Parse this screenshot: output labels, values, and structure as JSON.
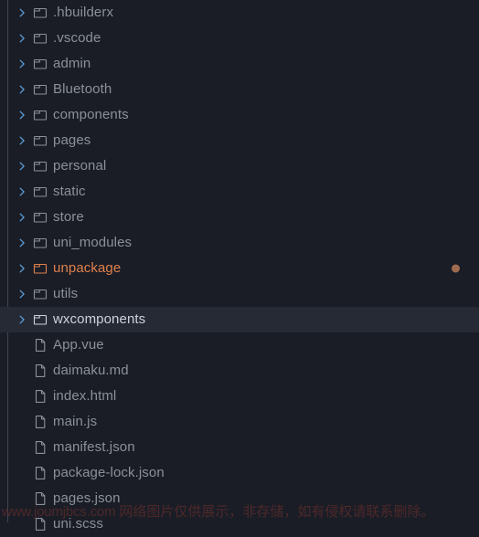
{
  "theme": {
    "background": "#1a1d26",
    "row_selected_background": "#252a35",
    "text": "#8b9199",
    "text_selected": "#cdd3da",
    "ignored_text": "#e0814c",
    "chevron": "#5a9bd5",
    "status_dot": "#9e6b50",
    "guide_line": "#41454f",
    "watermark_text": "#6d2f2c"
  },
  "explorer": {
    "rows": [
      {
        "name": ".hbuilderx",
        "kind": "folder",
        "icon": "folder-icon",
        "twisty": "chevron-right-icon",
        "expanded": false,
        "selected": false,
        "ignored": false,
        "status_dot": false
      },
      {
        "name": ".vscode",
        "kind": "folder",
        "icon": "folder-icon",
        "twisty": "chevron-right-icon",
        "expanded": false,
        "selected": false,
        "ignored": false,
        "status_dot": false
      },
      {
        "name": "admin",
        "kind": "folder",
        "icon": "folder-icon",
        "twisty": "chevron-right-icon",
        "expanded": false,
        "selected": false,
        "ignored": false,
        "status_dot": false
      },
      {
        "name": "Bluetooth",
        "kind": "folder",
        "icon": "folder-icon",
        "twisty": "chevron-right-icon",
        "expanded": false,
        "selected": false,
        "ignored": false,
        "status_dot": false
      },
      {
        "name": "components",
        "kind": "folder",
        "icon": "folder-icon",
        "twisty": "chevron-right-icon",
        "expanded": false,
        "selected": false,
        "ignored": false,
        "status_dot": false
      },
      {
        "name": "pages",
        "kind": "folder",
        "icon": "folder-icon",
        "twisty": "chevron-right-icon",
        "expanded": false,
        "selected": false,
        "ignored": false,
        "status_dot": false
      },
      {
        "name": "personal",
        "kind": "folder",
        "icon": "folder-icon",
        "twisty": "chevron-right-icon",
        "expanded": false,
        "selected": false,
        "ignored": false,
        "status_dot": false
      },
      {
        "name": "static",
        "kind": "folder",
        "icon": "folder-icon",
        "twisty": "chevron-right-icon",
        "expanded": false,
        "selected": false,
        "ignored": false,
        "status_dot": false
      },
      {
        "name": "store",
        "kind": "folder",
        "icon": "folder-icon",
        "twisty": "chevron-right-icon",
        "expanded": false,
        "selected": false,
        "ignored": false,
        "status_dot": false
      },
      {
        "name": "uni_modules",
        "kind": "folder",
        "icon": "folder-icon",
        "twisty": "chevron-right-icon",
        "expanded": false,
        "selected": false,
        "ignored": false,
        "status_dot": false
      },
      {
        "name": "unpackage",
        "kind": "folder",
        "icon": "folder-icon",
        "twisty": "chevron-right-icon",
        "expanded": false,
        "selected": false,
        "ignored": true,
        "status_dot": true
      },
      {
        "name": "utils",
        "kind": "folder",
        "icon": "folder-icon",
        "twisty": "chevron-right-icon",
        "expanded": false,
        "selected": false,
        "ignored": false,
        "status_dot": false
      },
      {
        "name": "wxcomponents",
        "kind": "folder",
        "icon": "folder-icon",
        "twisty": "chevron-right-icon",
        "expanded": false,
        "selected": true,
        "ignored": false,
        "status_dot": false
      },
      {
        "name": "App.vue",
        "kind": "file",
        "icon": "file-icon",
        "twisty": "none",
        "expanded": false,
        "selected": false,
        "ignored": false,
        "status_dot": false
      },
      {
        "name": "daimaku.md",
        "kind": "file",
        "icon": "file-icon",
        "twisty": "none",
        "expanded": false,
        "selected": false,
        "ignored": false,
        "status_dot": false
      },
      {
        "name": "index.html",
        "kind": "file",
        "icon": "file-icon",
        "twisty": "none",
        "expanded": false,
        "selected": false,
        "ignored": false,
        "status_dot": false
      },
      {
        "name": "main.js",
        "kind": "file",
        "icon": "file-icon",
        "twisty": "none",
        "expanded": false,
        "selected": false,
        "ignored": false,
        "status_dot": false
      },
      {
        "name": "manifest.json",
        "kind": "file",
        "icon": "file-icon",
        "twisty": "none",
        "expanded": false,
        "selected": false,
        "ignored": false,
        "status_dot": false
      },
      {
        "name": "package-lock.json",
        "kind": "file",
        "icon": "file-icon",
        "twisty": "none",
        "expanded": false,
        "selected": false,
        "ignored": false,
        "status_dot": false
      },
      {
        "name": "pages.json",
        "kind": "file",
        "icon": "file-icon",
        "twisty": "none",
        "expanded": false,
        "selected": false,
        "ignored": false,
        "status_dot": false
      },
      {
        "name": "uni.scss",
        "kind": "file",
        "icon": "file-icon",
        "twisty": "none",
        "expanded": false,
        "selected": false,
        "ignored": false,
        "status_dot": false
      }
    ]
  },
  "watermark": {
    "url": "www.joumjbcs.com",
    "note": "网络图片仅供展示，非存储，如有侵权请联系删除。"
  }
}
